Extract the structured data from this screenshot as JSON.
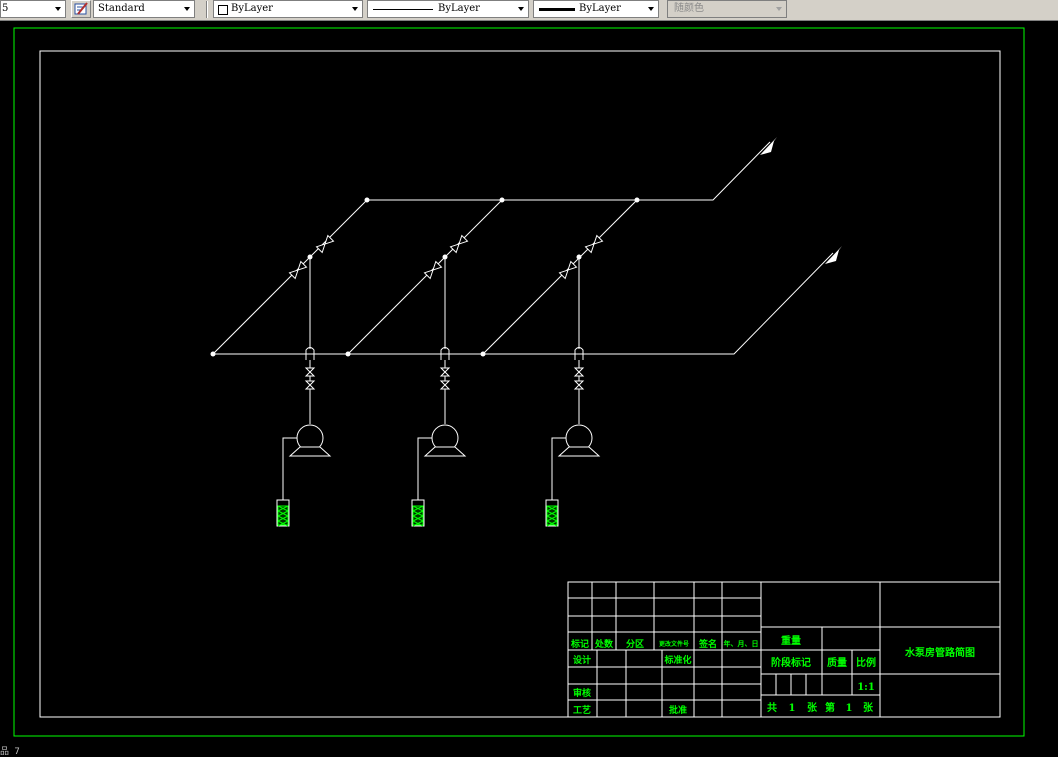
{
  "toolbar": {
    "layer_value": "5",
    "text_style": "Standard",
    "color": "ByLayer",
    "linetype": "ByLayer",
    "lineweight": "ByLayer",
    "plot_style": "随颜色"
  },
  "title_block": {
    "col_labels": [
      "标记",
      "处数",
      "分区",
      "更改文件号",
      "签名",
      "年、月、日"
    ],
    "design_label": "设计",
    "standardize_label": "标准化",
    "review_label": "审核",
    "process_label": "工艺",
    "approve_label": "批准",
    "weight_label": "重量",
    "stage_mark_label": "阶段标记",
    "mass_label": "质量",
    "scale_label": "比例",
    "scale_value": "1:1",
    "sheets_total_prefix": "共",
    "sheets_total": "1",
    "sheets_unit": "张",
    "sheet_no_prefix": "第",
    "sheet_no": "1",
    "drawing_title": "水泵房管路简图"
  },
  "command_line": {
    "text": "品 7"
  },
  "colors": {
    "background": "#000000",
    "drawing_lines": "#ffffff",
    "outer_frame": "#00ff00",
    "table_text": "#00ff00",
    "table_lines": "#ffffff",
    "suction_filter": "#00ff00"
  }
}
